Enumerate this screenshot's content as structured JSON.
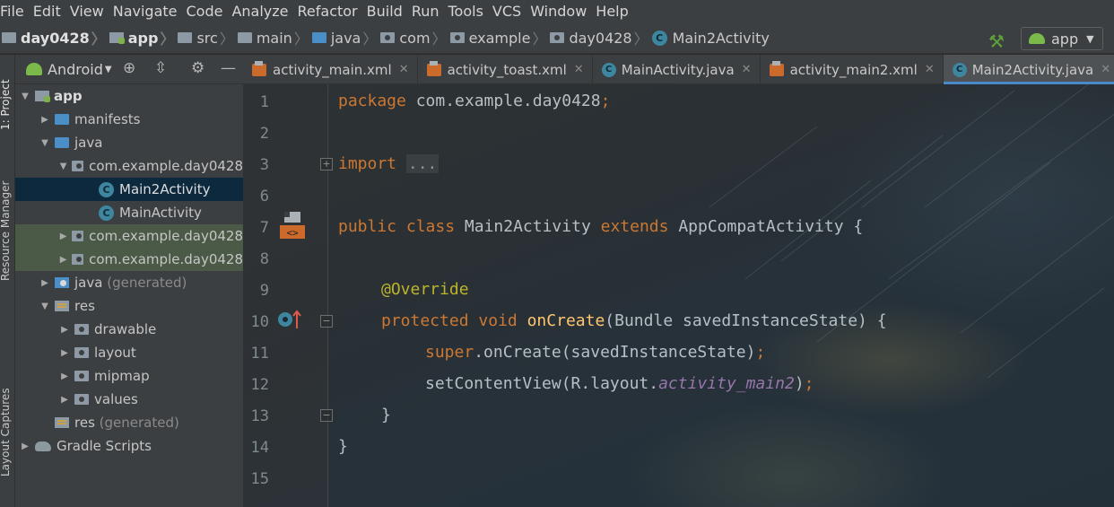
{
  "menu": [
    "File",
    "Edit",
    "View",
    "Navigate",
    "Code",
    "Analyze",
    "Refactor",
    "Build",
    "Run",
    "Tools",
    "VCS",
    "Window",
    "Help"
  ],
  "breadcrumb": [
    "day0428",
    "app",
    "src",
    "main",
    "java",
    "com",
    "example",
    "day0428",
    "Main2Activity"
  ],
  "run_config": {
    "label": "app"
  },
  "tool_windows": {
    "project": "1: Project",
    "resource_manager": "Resource Manager",
    "layout_captures": "Layout Captures"
  },
  "project_panel": {
    "view": "Android",
    "tree": [
      {
        "label": "app",
        "bold": true
      },
      {
        "label": "manifests"
      },
      {
        "label": "java"
      },
      {
        "label": "com.example.day0428"
      },
      {
        "label": "Main2Activity"
      },
      {
        "label": "MainActivity"
      },
      {
        "label": "com.example.day0428"
      },
      {
        "label": "com.example.day0428"
      },
      {
        "label": "java",
        "suffix": "(generated)"
      },
      {
        "label": "res"
      },
      {
        "label": "drawable"
      },
      {
        "label": "layout"
      },
      {
        "label": "mipmap"
      },
      {
        "label": "values"
      },
      {
        "label": "res",
        "suffix": "(generated)"
      },
      {
        "label": "Gradle Scripts"
      }
    ]
  },
  "tabs": [
    {
      "label": "activity_main.xml",
      "type": "xml"
    },
    {
      "label": "activity_toast.xml",
      "type": "xml"
    },
    {
      "label": "MainActivity.java",
      "type": "class"
    },
    {
      "label": "activity_main2.xml",
      "type": "xml"
    },
    {
      "label": "Main2Activity.java",
      "type": "class",
      "active": true
    }
  ],
  "code": {
    "line_numbers": [
      "1",
      "2",
      "3",
      "6",
      "7",
      "8",
      "9",
      "10",
      "11",
      "12",
      "13",
      "14",
      "15"
    ],
    "l1_kw": "package",
    "l1_rest": " com.example.day0428",
    "l3_kw": "import",
    "l3_fold": "...",
    "l7_kw1": "public",
    "l7_kw2": "class",
    "l7_name": " Main2Activity ",
    "l7_kw3": "extends",
    "l7_rest": " AppCompatActivity {",
    "l9_ann": "@Override",
    "l10_kw1": "protected",
    "l10_kw2": "void",
    "l10_fn": "onCreate",
    "l10_rest": "(Bundle savedInstanceState) {",
    "l11_kw": "super",
    "l11_rest": ".onCreate(savedInstanceState)",
    "l12_rest": "setContentView(R.layout.",
    "l12_field": "activity_main2",
    "semicolon": ";",
    "paren_close": ")",
    "l13": "}",
    "l14": "}"
  }
}
